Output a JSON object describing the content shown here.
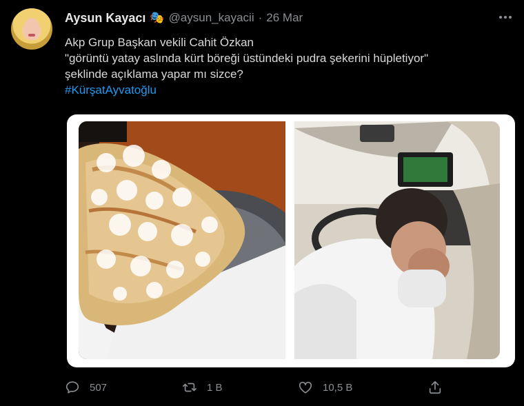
{
  "tweet": {
    "display_name": "Aysun Kayacı",
    "name_emoji": "🎭",
    "handle": "@aysun_kayacii",
    "separator": "·",
    "date": "26 Mar",
    "text_lines": [
      "Akp Grup Başkan vekili Cahit Özkan",
      "\"görüntü yatay aslında kürt böreği üstündeki pudra şekerini hüpletiyor\"",
      "şeklinde açıklama yapar mı sizce?"
    ],
    "hashtag": "#KürşatAyvatoğlu",
    "media": [
      {
        "icon": "pastry-photo"
      },
      {
        "icon": "man-in-car-photo"
      }
    ],
    "actions": {
      "reply_icon": "reply-icon",
      "reply_count": "507",
      "retweet_icon": "retweet-icon",
      "retweet_count": "1 B",
      "like_icon": "heart-icon",
      "like_count": "10,5 B",
      "share_icon": "share-icon"
    }
  },
  "colors": {
    "background": "#000000",
    "text": "#d9d9d9",
    "muted": "#8b8f94",
    "hashtag": "#1d9bf0"
  }
}
